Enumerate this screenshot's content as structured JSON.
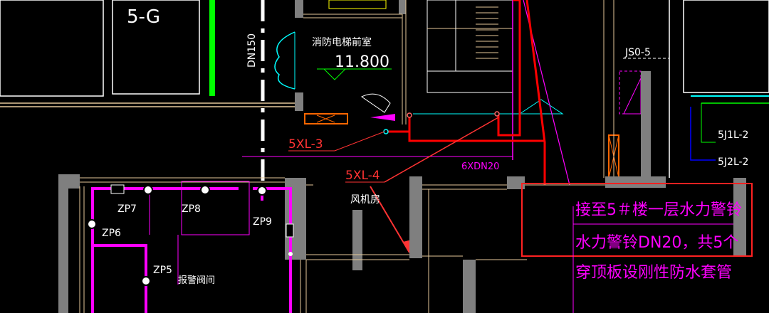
{
  "labels": {
    "room_5g": "5-G",
    "pipe_dn150": "DN150",
    "fire_lobby": "消防电梯前室",
    "elevation": "11.800",
    "js": "JS0-5",
    "xl3": "5XL-3",
    "xl4": "5XL-4",
    "dn20": "6XDN20",
    "fan_room": "风机房",
    "zp5": "ZP5",
    "zp6": "ZP6",
    "zp7": "ZP7",
    "zp8": "ZP8",
    "zp9": "ZP9",
    "alarm_valve_room": "报警阀间",
    "j1l2": "5J1L-2",
    "j2l2": "5J2L-2",
    "note_line1": "接至5＃楼一层水力警铃",
    "note_line2": "水力警铃DN20，共5个",
    "note_line3": "穿顶板设刚性防水套管"
  },
  "colors": {
    "background": "#000000",
    "wall": "#7f7f7f",
    "fire_pipe": "#ff00ff",
    "red_pipe": "#ff0000",
    "annotation": "#ff3333",
    "tan": "#e6c89a",
    "white": "#ffffff",
    "cyan": "#00ffff",
    "green": "#00ff00",
    "blue": "#0000ff"
  }
}
